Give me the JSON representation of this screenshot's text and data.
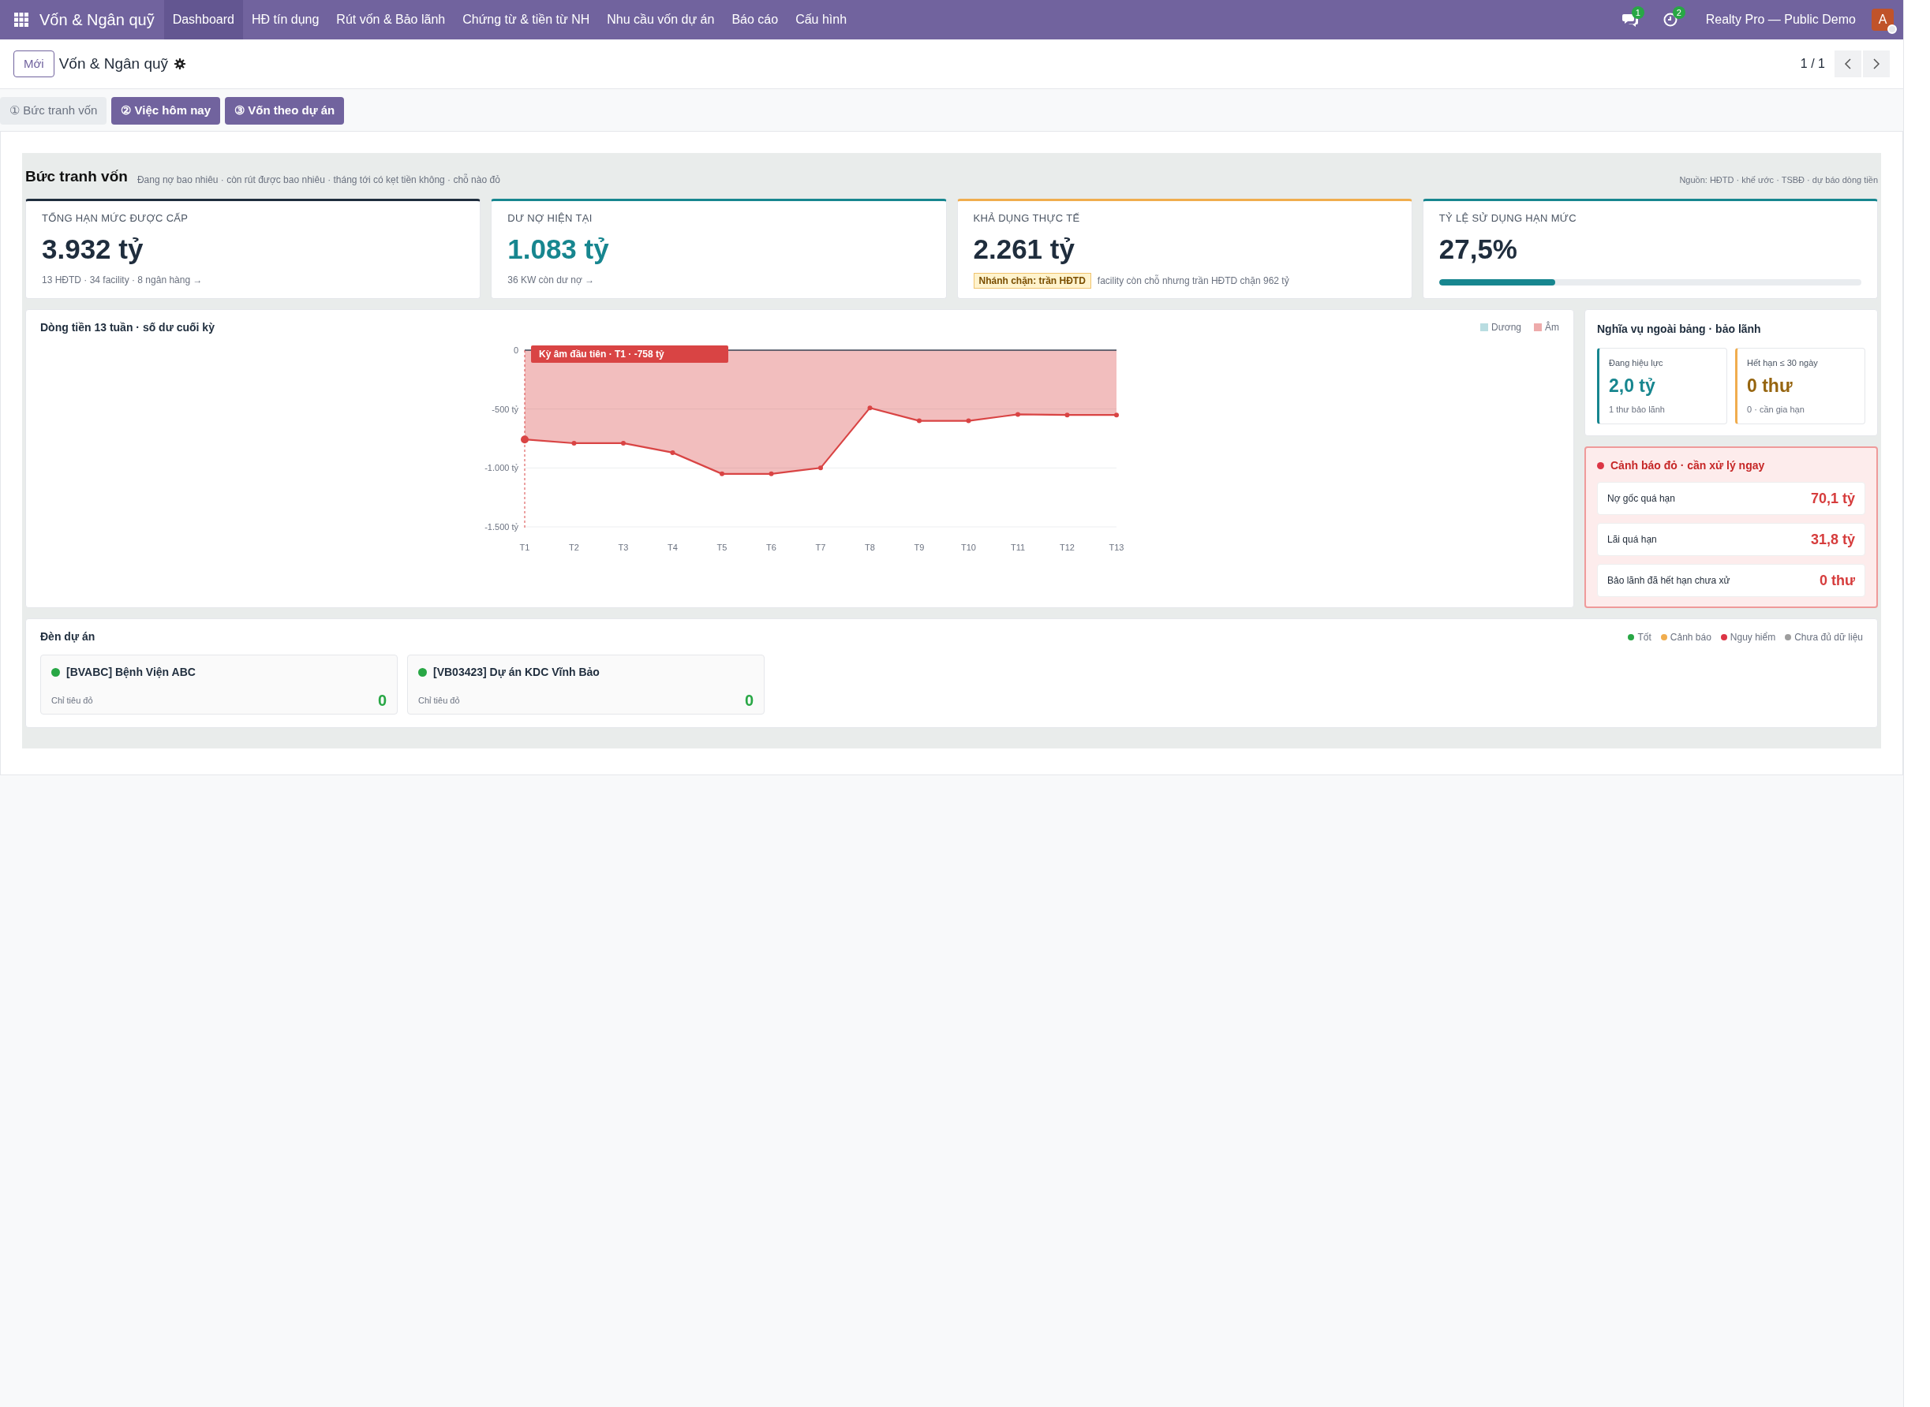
{
  "navbar": {
    "app_name": "Vốn & Ngân quỹ",
    "menu": [
      {
        "label": "Dashboard",
        "selected": true
      },
      {
        "label": "HĐ tín dụng",
        "selected": false
      },
      {
        "label": "Rút vốn & Bảo lãnh",
        "selected": false
      },
      {
        "label": "Chứng từ & tiền từ NH",
        "selected": false
      },
      {
        "label": "Nhu cầu vốn dự án",
        "selected": false
      },
      {
        "label": "Báo cáo",
        "selected": false
      },
      {
        "label": "Cấu hình",
        "selected": false
      }
    ],
    "messages_count": "1",
    "activities_count": "2",
    "company": "Realty Pro — Public Demo",
    "avatar_letter": "A"
  },
  "control_panel": {
    "new_button": "Mới",
    "title": "Vốn & Ngân quỹ",
    "pager": "1 / 1"
  },
  "section_tabs": [
    {
      "label": "① Bức tranh vốn",
      "selected": true
    },
    {
      "label": "② Việc hôm nay",
      "selected": false
    },
    {
      "label": "③ Vốn theo dự án",
      "selected": false
    }
  ],
  "overview": {
    "title": "Bức tranh vốn",
    "subtitle": "Đang nợ bao nhiêu · còn rút được bao nhiêu · tháng tới có kẹt tiền không · chỗ nào đỏ",
    "source": "Nguồn: HĐTD · khế ước · TSBĐ · dự báo dòng tiền"
  },
  "kpis": [
    {
      "kind": "note",
      "label": "TỔNG HẠN MỨC ĐƯỢC CẤP",
      "value": "3.932 tỷ",
      "note": "13 HĐTD · 34 facility · 8 ngân hàng →",
      "color": "#1f2d3d"
    },
    {
      "kind": "note",
      "label": "DƯ NỢ HIỆN TẠI",
      "value": "1.083 tỷ",
      "note": "36 KW còn dư nợ →",
      "color": "#17868f"
    },
    {
      "kind": "badge",
      "label": "KHẢ DỤNG THỰC TẾ",
      "value": "2.261 tỷ",
      "badge": "Nhánh chặn: trần HĐTD",
      "note": "facility còn chỗ nhưng trần HĐTD chặn 962 tỷ",
      "color": "#f0ad4e"
    },
    {
      "kind": "progress",
      "label": "TỶ LỆ SỬ DỤNG HẠN MỨC",
      "value": "27,5%",
      "level": 0.275,
      "color": "#17868f"
    }
  ],
  "cashflow": {
    "chart_data": {
      "type": "area",
      "title": "Dòng tiền 13 tuần · số dư cuối kỳ",
      "categories": [
        "T1",
        "T2",
        "T3",
        "T4",
        "T5",
        "T6",
        "T7",
        "T8",
        "T9",
        "T10",
        "T11",
        "T12",
        "T13"
      ],
      "series": [
        {
          "name": "Dương",
          "color": "#b9dde1",
          "values": [
            null,
            null,
            null,
            null,
            null,
            null,
            null,
            null,
            null,
            null,
            null,
            null,
            null
          ]
        },
        {
          "name": "Âm",
          "color": "#d94444",
          "values": [
            -758,
            -790,
            -790,
            -870,
            -1050,
            -1050,
            -1000,
            -490,
            -600,
            -600,
            -545,
            -550,
            -550
          ]
        }
      ],
      "ylim": [
        -1500,
        0
      ],
      "yticks": [
        {
          "value": 0,
          "label": "0"
        },
        {
          "value": -500,
          "label": "-500 tỷ"
        },
        {
          "value": -1000,
          "label": "-1.000 tỷ"
        },
        {
          "value": -1500,
          "label": "-1.500 tỷ"
        }
      ],
      "annotations": [
        {
          "x": "T1",
          "text": "Kỳ âm đầu tiên · T1 · -758 tỷ"
        }
      ]
    }
  },
  "obligations": {
    "title": "Nghĩa vụ ngoài bảng · bảo lãnh",
    "tiles": [
      {
        "label": "Đang hiệu lực",
        "value": "2,0 tỷ",
        "note": "1 thư bảo lãnh",
        "color": "#17868f"
      },
      {
        "label": "Hết hạn ≤ 30 ngày",
        "value": "0 thư",
        "note": "0 · cần gia hạn",
        "color": "#f0ad4e"
      }
    ]
  },
  "red_alerts": {
    "title": "Cảnh báo đỏ · cần xử lý ngay",
    "items": [
      {
        "label": "Nợ gốc quá hạn",
        "value": "70,1 tỷ"
      },
      {
        "label": "Lãi quá hạn",
        "value": "31,8 tỷ"
      },
      {
        "label": "Bảo lãnh đã hết hạn chưa xử",
        "value": "0 thư"
      }
    ]
  },
  "projects": {
    "title": "Đèn dự án",
    "legend": [
      {
        "label": "Tốt",
        "color": "#28a745"
      },
      {
        "label": "Cảnh báo",
        "color": "#f0ad4e"
      },
      {
        "label": "Nguy hiểm",
        "color": "#dc3545"
      },
      {
        "label": "Chưa đủ dữ liệu",
        "color": "#9e9e9e"
      }
    ],
    "items": [
      {
        "name": "[BVABC] Bệnh Viện ABC",
        "metric_label": "Chỉ tiêu đỏ",
        "metric_value": "0",
        "color": "#28a745"
      },
      {
        "name": "[VB03423] Dự án KDC Vĩnh Bảo",
        "metric_label": "Chỉ tiêu đỏ",
        "metric_value": "0",
        "color": "#28a745"
      }
    ]
  }
}
